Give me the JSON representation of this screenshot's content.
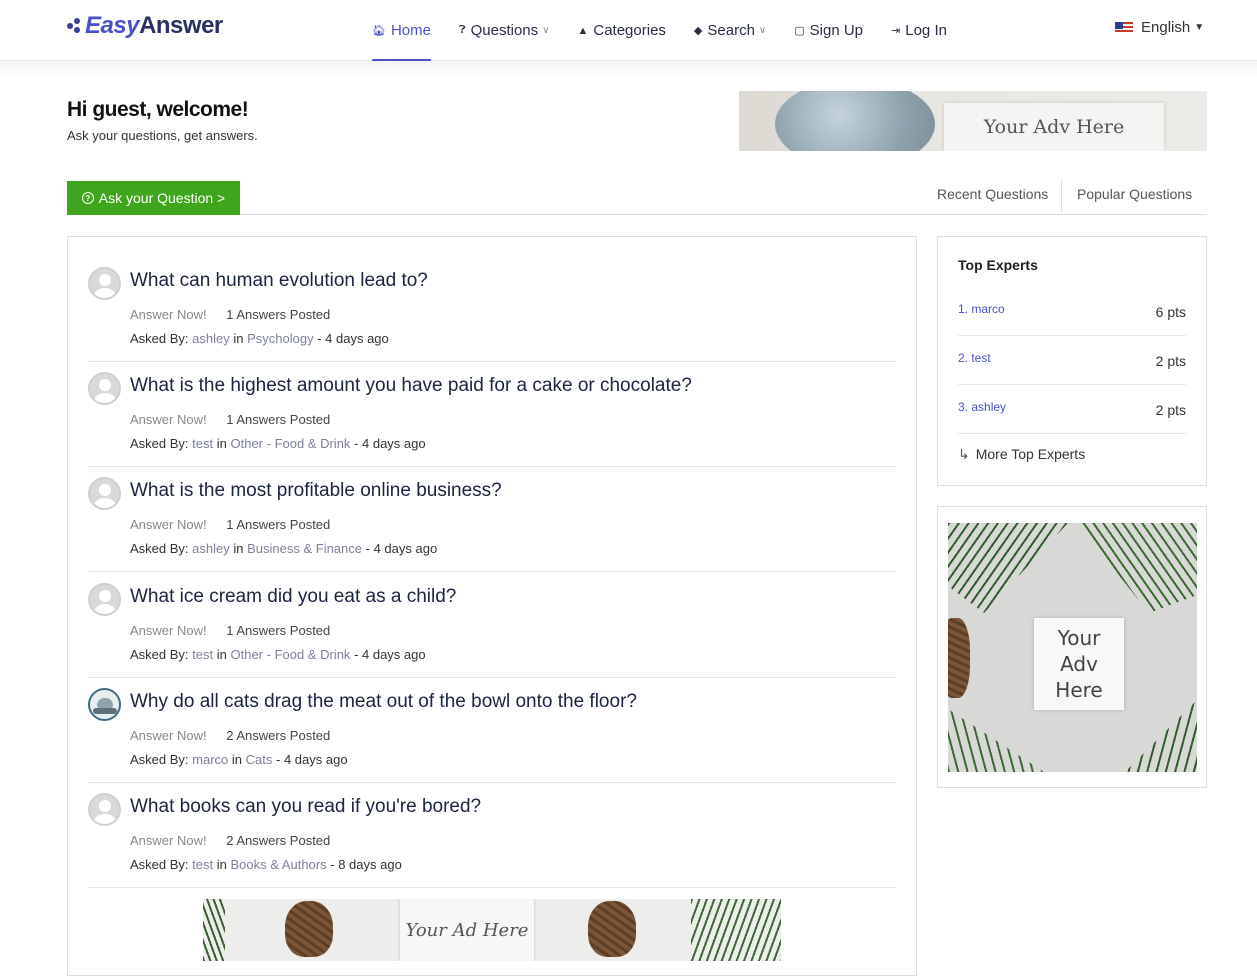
{
  "brand": {
    "easy": "Easy",
    "answer": "Answer"
  },
  "nav": {
    "home": "Home",
    "questions": "Questions",
    "categories": "Categories",
    "search": "Search",
    "signup": "Sign Up",
    "login": "Log In",
    "language": "English"
  },
  "welcome": {
    "title": "Hi guest, welcome!",
    "subtitle": "Ask your questions, get answers."
  },
  "ads": {
    "top": "Your Adv Here",
    "side": "Your Adv Here",
    "bottom": "Your Ad Here"
  },
  "ask_button": "Ask your Question >",
  "tabs": {
    "recent": "Recent Questions",
    "popular": "Popular Questions"
  },
  "questions": [
    {
      "title": "What can human evolution lead to?",
      "answer_now": "Answer Now!",
      "answers": "1 Answers Posted",
      "asked_by": "Asked By:",
      "user": "ashley",
      "in": "in",
      "category": "Psychology",
      "time": "- 4 days ago"
    },
    {
      "title": "What is the highest amount you have paid for a cake or chocolate?",
      "answer_now": "Answer Now!",
      "answers": "1 Answers Posted",
      "asked_by": "Asked By:",
      "user": "test",
      "in": "in",
      "category": "Other - Food & Drink",
      "time": "- 4 days ago"
    },
    {
      "title": "What is the most profitable online business?",
      "answer_now": "Answer Now!",
      "answers": "1 Answers Posted",
      "asked_by": "Asked By:",
      "user": "ashley",
      "in": "in",
      "category": "Business & Finance",
      "time": "- 4 days ago"
    },
    {
      "title": "What ice cream did you eat as a child?",
      "answer_now": "Answer Now!",
      "answers": "1 Answers Posted",
      "asked_by": "Asked By:",
      "user": "test",
      "in": "in",
      "category": "Other - Food & Drink",
      "time": "- 4 days ago"
    },
    {
      "title": "Why do all cats drag the meat out of the bowl onto the floor?",
      "answer_now": "Answer Now!",
      "answers": "2 Answers Posted",
      "asked_by": "Asked By:",
      "user": "marco",
      "in": "in",
      "category": "Cats",
      "time": "- 4 days ago"
    },
    {
      "title": "What books can you read if you're bored?",
      "answer_now": "Answer Now!",
      "answers": "2 Answers Posted",
      "asked_by": "Asked By:",
      "user": "test",
      "in": "in",
      "category": "Books & Authors",
      "time": "- 8 days ago"
    }
  ],
  "top_experts": {
    "title": "Top Experts",
    "list": [
      {
        "name": "1. marco",
        "points": "6 pts"
      },
      {
        "name": "2. test",
        "points": "2 pts"
      },
      {
        "name": "3. ashley",
        "points": "2 pts"
      }
    ],
    "more": "More Top Experts"
  },
  "colors": {
    "accent": "#4a50c8",
    "ask_button": "#3fa51c",
    "title": "#1b2440"
  }
}
